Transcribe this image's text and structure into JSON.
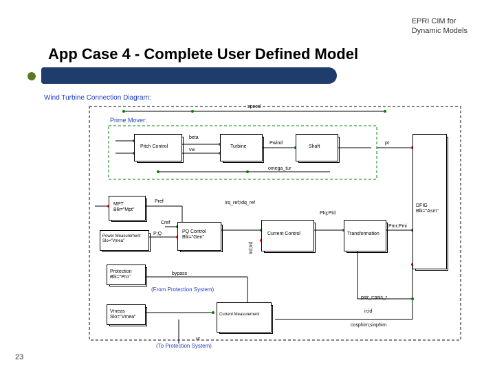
{
  "header": {
    "org": "EPRI CIM for",
    "sub": "Dynamic Models"
  },
  "title": "App Case 4 - Complete User Defined  Model",
  "pagenum": "23",
  "diagram": {
    "caption": "Wind Turbine Connection Diagram:",
    "prime_mover_label": "Prime Mover:",
    "blocks": {
      "pitch_control": "Pitch Control",
      "turbine": "Turbine",
      "shaft": "Shaft",
      "mpt": "MPT\nBlk=\"Mpt\"",
      "pq_control": "PQ Control\nBlk=\"Gen\"",
      "current_control": "Current Control",
      "transformation": "Transformation",
      "dfig": "DFIG\nBlk=\"Asm\"",
      "power_measurement": "Power Measurement\nSlo=\"Vmea\"",
      "protection": "Protection\nBlk=\"Pro\"",
      "vmeas": "Vmeas\nSlo=\"Vmea\"",
      "current_measurement": "Current Measurement"
    },
    "signals": {
      "speed": "speed",
      "beta": "beta",
      "vw": "vw",
      "pwind": "Pwind",
      "pt": "pt",
      "omega_tur": "omega_tur",
      "pref": "Pref",
      "p_q": "P;Q",
      "cref": "Cref",
      "irq_ref": "Irq_ref;Idq_ref",
      "piq_pid": "PIq;PId",
      "pmr_pmi": "Pmr;Pmi",
      "bypass": "bypass",
      "ird_ird": "Ird;Ird",
      "psir_psis": "psir_r;psis_r",
      "ir_id": "ir;id",
      "cosphim": "cosphim;sinphim",
      "ur": "ur",
      "from_protection": "(From Protection System)",
      "to_protection": "(To Protection System)"
    }
  }
}
